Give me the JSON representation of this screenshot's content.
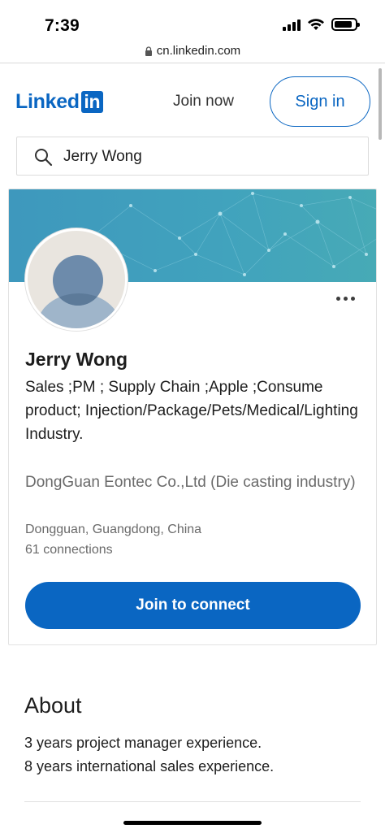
{
  "status_bar": {
    "time": "7:39",
    "icons": [
      "cellular-signal-icon",
      "wifi-icon",
      "battery-icon"
    ]
  },
  "browser": {
    "url": "cn.linkedin.com",
    "lock_icon": "lock-icon"
  },
  "header": {
    "logo_text": "Linked",
    "logo_badge": "in",
    "join_now": "Join now",
    "sign_in": "Sign in"
  },
  "search": {
    "value": "Jerry Wong",
    "icon": "search-icon"
  },
  "profile": {
    "name": "Jerry Wong",
    "headline": "Sales ;PM ; Supply Chain ;Apple ;Consume product; Injection/Package/Pets/Medical/Lighting Industry.",
    "company": "DongGuan Eontec Co.,Ltd (Die casting industry)",
    "location": "Dongguan, Guangdong, China",
    "connections": "61 connections",
    "join_button": "Join to connect"
  },
  "about": {
    "title": "About",
    "lines": [
      "3 years project manager experience.",
      "8 years international sales experience."
    ]
  },
  "colors": {
    "brand": "#0a66c2",
    "banner": "#41a3bd",
    "muted_text": "#6a6a6a"
  }
}
